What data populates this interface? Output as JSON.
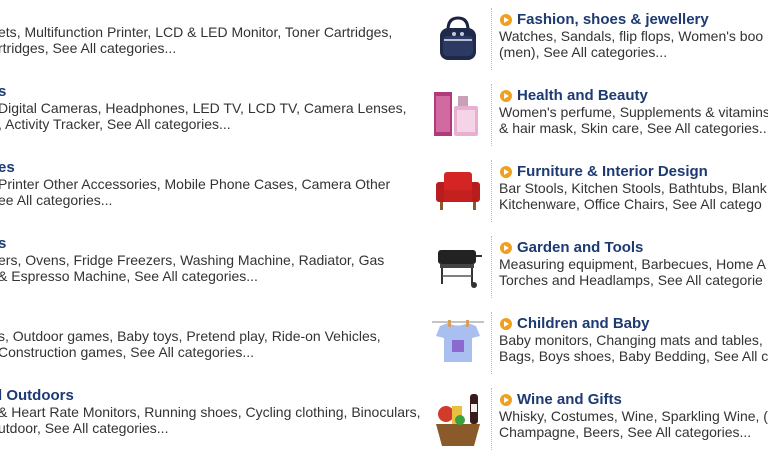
{
  "left": [
    {
      "title": "",
      "lines": [
        [
          "ets",
          "Multifunction Printer",
          "LCD & LED Monitor",
          "Toner Cartridges,"
        ],
        [
          "rtridges",
          "See All categories..."
        ]
      ]
    },
    {
      "title": "s",
      "lines": [
        [
          "Digital Cameras",
          "Headphones",
          "LED TV",
          "LCD TV",
          "Camera Lenses,"
        ],
        [
          ", Activity Tracker",
          "See All categories..."
        ]
      ]
    },
    {
      "title": "es",
      "lines": [
        [
          "Printer Other Accessories",
          "Mobile Phone Cases",
          "Camera Other"
        ],
        [
          "ee All categories..."
        ]
      ]
    },
    {
      "title": "s",
      "lines": [
        [
          "ers",
          "Ovens",
          "Fridge Freezers",
          "Washing Machine",
          "Radiator",
          "Gas"
        ],
        [
          "& Espresso Machine",
          "See All categories..."
        ]
      ]
    },
    {
      "title": "",
      "lines": [
        [
          "s",
          "Outdoor games",
          "Baby toys",
          "Pretend play",
          "Ride-on Vehicles,"
        ],
        [
          "Construction games",
          "See All categories..."
        ]
      ]
    },
    {
      "title": "l Outdoors",
      "lines": [
        [
          "& Heart Rate Monitors",
          "Running shoes",
          "Cycling clothing",
          "Binoculars,"
        ],
        [
          "utdoor",
          "See All categories..."
        ]
      ]
    }
  ],
  "right": [
    {
      "title": "Fashion, shoes & jewellery",
      "icon": "handbag-icon",
      "lines": [
        [
          "Watches",
          "Sandals",
          "flip flops",
          "Women's boo"
        ],
        [
          "(men)",
          "See All categories..."
        ]
      ]
    },
    {
      "title": "Health and Beauty",
      "icon": "perfume-icon",
      "lines": [
        [
          "Women's perfume",
          "Supplements & vitamins"
        ],
        [
          "& hair mask",
          "Skin care",
          "See All categories..."
        ]
      ]
    },
    {
      "title": "Furniture & Interior Design",
      "icon": "armchair-icon",
      "lines": [
        [
          "Bar Stools",
          "Kitchen Stools",
          "Bathtubs",
          "Blank"
        ],
        [
          "Kitchenware",
          "Office Chairs",
          "See All catego"
        ]
      ]
    },
    {
      "title": "Garden and Tools",
      "icon": "barbecue-icon",
      "lines": [
        [
          "Measuring equipment",
          "Barbecues",
          "Home A"
        ],
        [
          "Torches and Headlamps",
          "See All categorie"
        ]
      ]
    },
    {
      "title": "Children and Baby",
      "icon": "baby-clothes-icon",
      "lines": [
        [
          "Baby monitors",
          "Changing mats and tables,"
        ],
        [
          "Bags",
          "Boys shoes",
          "Baby Bedding",
          "See All c"
        ]
      ]
    },
    {
      "title": "Wine and Gifts",
      "icon": "gift-basket-icon",
      "lines": [
        [
          "Whisky",
          "Costumes",
          "Wine",
          "Sparkling Wine",
          "("
        ],
        [
          "Champagne",
          "Beers",
          "See All categories..."
        ]
      ]
    }
  ]
}
